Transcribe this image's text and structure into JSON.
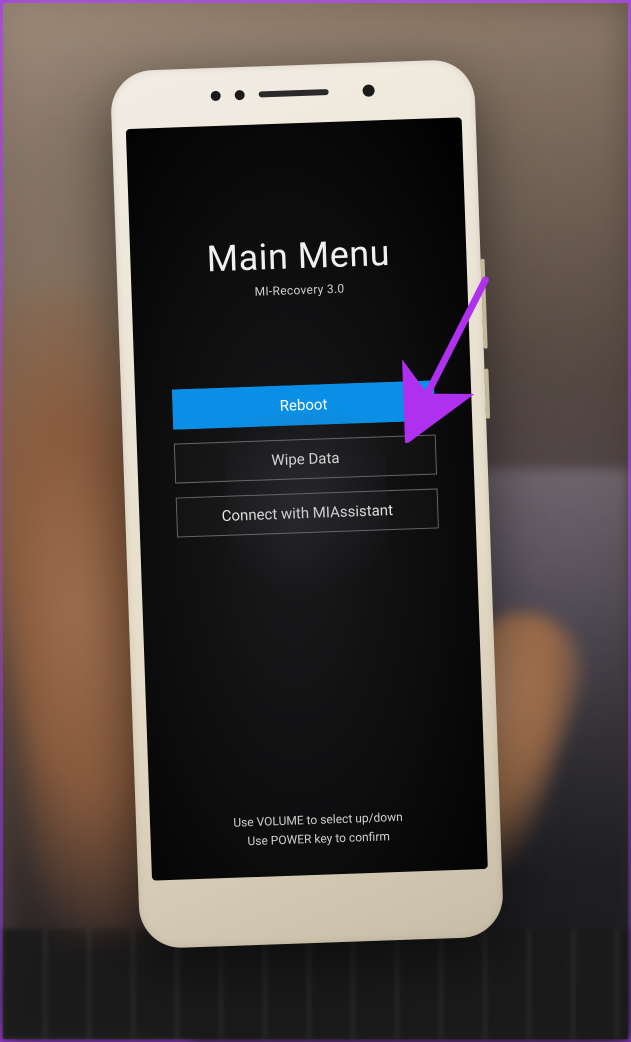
{
  "recovery": {
    "title": "Main Menu",
    "subtitle": "MI-Recovery 3.0",
    "options": [
      {
        "label": "Reboot",
        "selected": true
      },
      {
        "label": "Wipe Data",
        "selected": false
      },
      {
        "label": "Connect with MIAssistant",
        "selected": false
      }
    ],
    "hint_line1": "Use VOLUME to select up/down",
    "hint_line2": "Use POWER key to confirm"
  },
  "annotation": {
    "arrow_color": "#b030f0"
  }
}
